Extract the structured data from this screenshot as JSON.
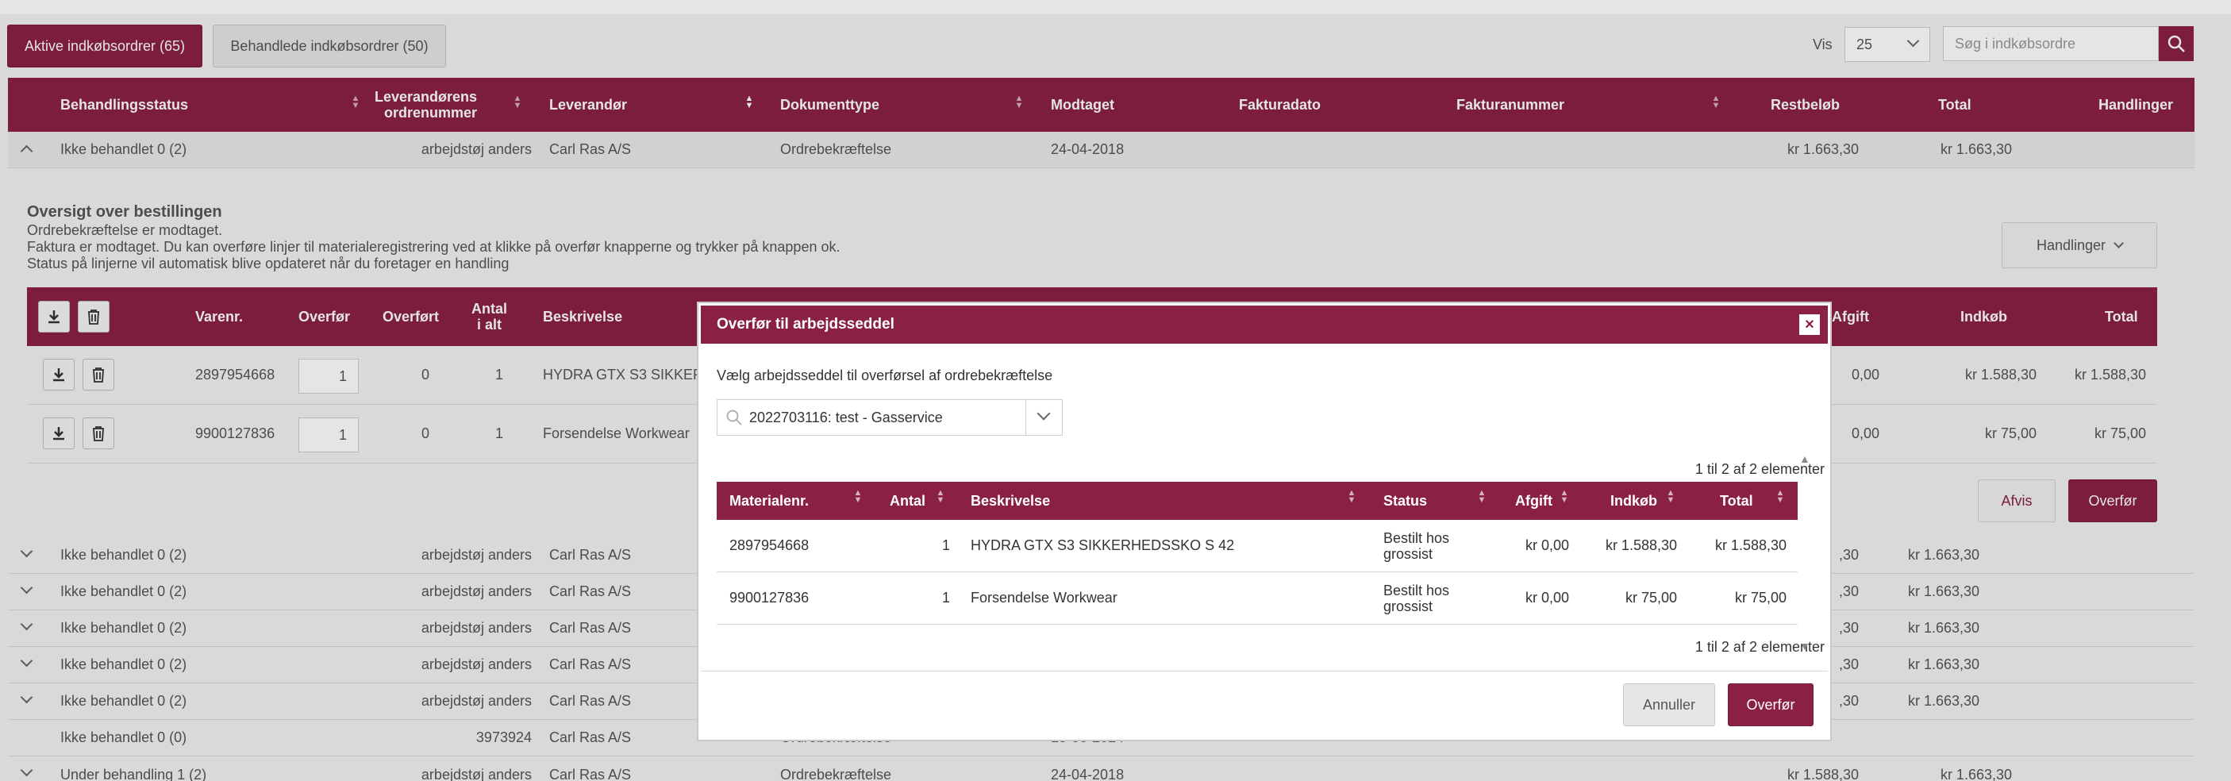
{
  "tabs": {
    "active_label": "Aktive indkøbsordrer (65)",
    "handled_label": "Behandlede indkøbsordrer (50)"
  },
  "toolbar": {
    "vis_label": "Vis",
    "page_size": "25",
    "search_placeholder": "Søg i indkøbsordre"
  },
  "main_table": {
    "headers": {
      "status": "Behandlingsstatus",
      "order_no_line1": "Leverandørens",
      "order_no_line2": "ordrenummer",
      "supplier": "Leverandør",
      "doctype": "Dokumenttype",
      "received": "Modtaget",
      "invoice_date": "Fakturadato",
      "invoice_no": "Fakturanummer",
      "remaining": "Restbeløb",
      "total": "Total",
      "actions": "Handlinger"
    },
    "expanded_row": {
      "status": "Ikke behandlet 0 (2)",
      "order_no": "arbejdstøj anders",
      "supplier": "Carl Ras A/S",
      "doctype": "Ordrebekræftelse",
      "received": "24-04-2018",
      "remaining": "kr 1.663,30",
      "total": "kr 1.663,30"
    },
    "rows": [
      {
        "status": "Ikke behandlet 0 (2)",
        "order_no": "arbejdstøj anders",
        "supplier": "Carl Ras A/S",
        "remaining": ",30",
        "total": "kr 1.663,30"
      },
      {
        "status": "Ikke behandlet 0 (2)",
        "order_no": "arbejdstøj anders",
        "supplier": "Carl Ras A/S",
        "remaining": ",30",
        "total": "kr 1.663,30"
      },
      {
        "status": "Ikke behandlet 0 (2)",
        "order_no": "arbejdstøj anders",
        "supplier": "Carl Ras A/S",
        "remaining": ",30",
        "total": "kr 1.663,30"
      },
      {
        "status": "Ikke behandlet 0 (2)",
        "order_no": "arbejdstøj anders",
        "supplier": "Carl Ras A/S",
        "remaining": ",30",
        "total": "kr 1.663,30"
      },
      {
        "status": "Ikke behandlet 0 (2)",
        "order_no": "arbejdstøj anders",
        "supplier": "Carl Ras A/S",
        "remaining": ",30",
        "total": "kr 1.663,30"
      },
      {
        "status": "Ikke behandlet 0 (0)",
        "order_no": "3973924",
        "supplier": "Carl Ras A/S",
        "doctype": "Ordrebekræftelse",
        "received": "15-06-2024"
      },
      {
        "status": "Under behandling 1 (2)",
        "order_no": "arbejdstøj anders",
        "supplier": "Carl Ras A/S",
        "doctype": "Ordrebekræftelse",
        "received": "24-04-2018",
        "remaining": "kr 1.588,30",
        "total": "kr 1.663,30"
      }
    ]
  },
  "overview": {
    "title": "Oversigt over bestillingen",
    "line1": "Ordrebekræftelse er modtaget.",
    "line2": "Faktura er modtaget. Du kan overføre linjer til materialeregistrering ved at klikke på overfør knapperne og trykker på knappen ok.",
    "line3": "Status på linjerne vil automatisk blive opdateret når du foretager en handling",
    "actions_label": "Handlinger",
    "table_headers": {
      "item_no": "Varenr.",
      "transfer": "Overfør",
      "transferred": "Overført",
      "count_line1": "Antal",
      "count_line2": "i alt",
      "description": "Beskrivelse",
      "fee": "Afgift",
      "purchase": "Indkøb",
      "total": "Total"
    },
    "lines": [
      {
        "item_no": "2897954668",
        "qty": "1",
        "transferred": "0",
        "count": "1",
        "description": "HYDRA GTX S3 SIKKER",
        "fee": "0,00",
        "purchase": "kr 1.588,30",
        "total": "kr 1.588,30"
      },
      {
        "item_no": "9900127836",
        "qty": "1",
        "transferred": "0",
        "count": "1",
        "description": "Forsendelse Workwear",
        "fee": "0,00",
        "purchase": "kr 75,00",
        "total": "kr 75,00"
      }
    ],
    "reject_label": "Afvis",
    "transfer_label": "Overfør"
  },
  "modal": {
    "title": "Overfør til arbejdsseddel",
    "close": "×",
    "prompt": "Vælg arbejdsseddel til overførsel af ordrebekræftelse",
    "selected_worksheet": "2022703116: test - Gasservice",
    "count_top": "1 til 2 af 2 elementer",
    "count_bottom": "1 til 2 af 2 elementer",
    "headers": {
      "material_no": "Materialenr.",
      "count": "Antal",
      "description": "Beskrivelse",
      "status": "Status",
      "fee": "Afgift",
      "purchase": "Indkøb",
      "total": "Total"
    },
    "rows": [
      {
        "material_no": "2897954668",
        "count": "1",
        "description": "HYDRA GTX S3 SIKKERHEDSSKO S 42",
        "status_line1": "Bestilt hos",
        "status_line2": "grossist",
        "fee": "kr 0,00",
        "purchase": "kr 1.588,30",
        "total": "kr 1.588,30"
      },
      {
        "material_no": "9900127836",
        "count": "1",
        "description": "Forsendelse Workwear",
        "status_line1": "Bestilt hos",
        "status_line2": "grossist",
        "fee": "kr 0,00",
        "purchase": "kr 75,00",
        "total": "kr 75,00"
      }
    ],
    "cancel_label": "Annuller",
    "transfer_label": "Overfør"
  }
}
